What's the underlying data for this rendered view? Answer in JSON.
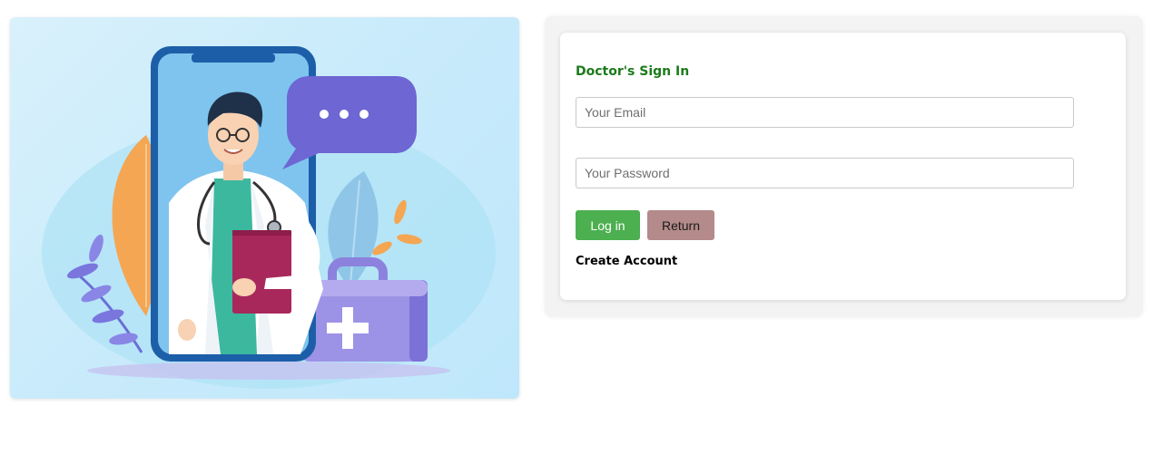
{
  "login": {
    "title": "Doctor's Sign In",
    "email_placeholder": "Your Email",
    "email_value": "",
    "password_placeholder": "Your Password",
    "password_value": "",
    "login_button_label": "Log in",
    "return_button_label": "Return",
    "create_account_label": "Create Account"
  },
  "colors": {
    "title_green": "#1b7a1b",
    "login_button": "#4caf50",
    "return_button": "#b48a8a",
    "chat_bubble": "#6d66d3",
    "phone_frame": "#1c5fa8"
  },
  "illustration": {
    "icon_names": [
      "doctor-figure-icon",
      "smartphone-icon",
      "chat-bubble-icon",
      "medical-kit-icon",
      "leaf-icon"
    ]
  }
}
